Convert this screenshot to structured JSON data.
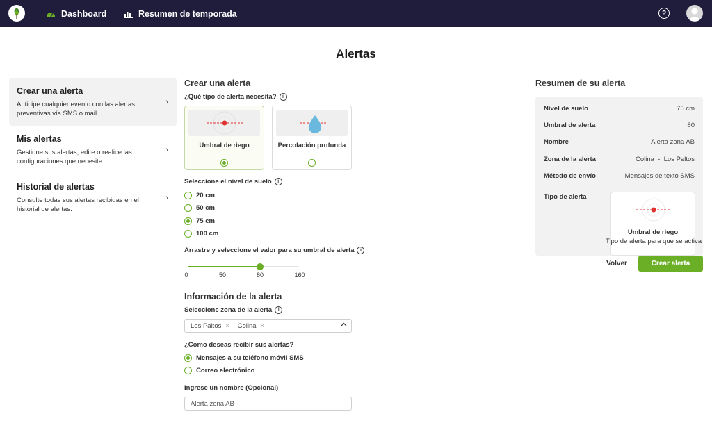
{
  "nav": {
    "items": [
      {
        "label": "Dashboard",
        "icon": "gauge-icon"
      },
      {
        "label": "Resumen de temporada",
        "icon": "bar-chart-icon"
      }
    ],
    "help_icon": "question-circle-icon",
    "avatar_icon": "user-avatar-icon",
    "logo_icon": "tree-logo-icon"
  },
  "page": {
    "title": "Alertas"
  },
  "menu": [
    {
      "title": "Crear una alerta",
      "desc": "Anticipe cualquier evento con las alertas preventivas vía SMS o mail."
    },
    {
      "title": "Mis alertas",
      "desc": "Gestione sus alertas, edite o realice las configuraciones que necesite."
    },
    {
      "title": "Historial de alertas",
      "desc": "Consulte todas sus alertas recibidas en el historial de alertas."
    }
  ],
  "form": {
    "title": "Crear una alerta",
    "type_question": "¿Qué tipo de alerta necesita?",
    "types": [
      {
        "label": "Umbral de riego",
        "selected": true
      },
      {
        "label": "Percolación profunda",
        "selected": false
      }
    ],
    "soil_label": "Seleccione el nivel de suelo",
    "soil_levels": [
      {
        "label": "20 cm",
        "selected": false
      },
      {
        "label": "50 cm",
        "selected": false
      },
      {
        "label": "75 cm",
        "selected": true
      },
      {
        "label": "100 cm",
        "selected": false
      }
    ],
    "threshold_label": "Arrastre y seleccione el valor para su umbral de alerta",
    "slider": {
      "min": 0,
      "max": 160,
      "value": 80,
      "ticks": [
        "0",
        "50",
        "80",
        "160"
      ]
    },
    "info_title": "Información de la alerta",
    "zone_label": "Seleccione zona de la alerta",
    "zones": [
      "Los Paltos",
      "Colina"
    ],
    "delivery_label": "¿Como deseas recibir sus alertas?",
    "delivery_options": [
      {
        "label": "Mensajes a su teléfono móvil SMS",
        "selected": true
      },
      {
        "label": "Correo electrónico",
        "selected": false
      }
    ],
    "name_label": "Ingrese un nombre (Opcional)",
    "name_value": "Alerta zona AB"
  },
  "summary": {
    "title": "Resumen de su alerta",
    "rows": [
      {
        "key": "Nivel de suelo",
        "value": "75 cm"
      },
      {
        "key": "Umbral de alerta",
        "value": "80"
      },
      {
        "key": "Nombre",
        "value": "Alerta zona AB"
      },
      {
        "key": "Zona de la alerta",
        "value": "Colina  -  Los Paltos"
      },
      {
        "key": "Método de envío",
        "value": "Mensajes de texto SMS"
      }
    ],
    "type_label": "Tipo de alerta",
    "type_card_title": "Umbral de riego",
    "type_card_sub": "Tipo de alerta para que se activa"
  },
  "actions": {
    "back": "Volver",
    "create": "Crear alerta"
  },
  "colors": {
    "nav_bg": "#1f1c3c",
    "accent": "#6aaf26",
    "panel_bg": "#f2f2f2",
    "threshold_red": "#e03030",
    "drop_blue": "#6bb8de"
  }
}
